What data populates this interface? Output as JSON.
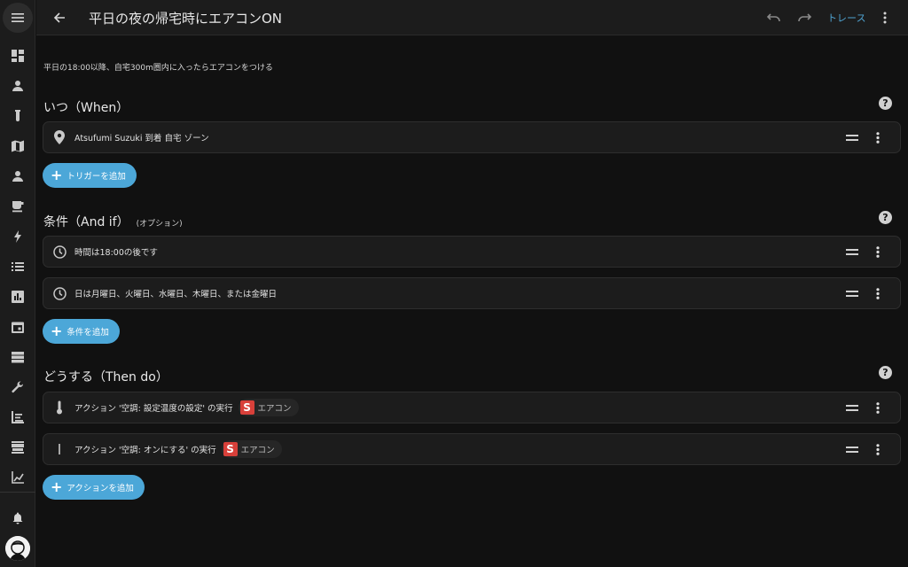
{
  "header": {
    "title": "平日の夜の帰宅時にエアコンON",
    "trace_label": "トレース"
  },
  "description": "平日の18:00以降、自宅300m圏内に入ったらエアコンをつける",
  "sections": {
    "when": {
      "title": "いつ（When）",
      "items": [
        {
          "icon": "map-marker-icon",
          "text": "Atsufumi Suzuki 到着 自宅 ゾーン"
        }
      ],
      "add_label": "トリガーを追加"
    },
    "and_if": {
      "title": "条件（And if）",
      "optional": "(オプション)",
      "items": [
        {
          "icon": "clock-icon",
          "text": "時間は18:00の後です"
        },
        {
          "icon": "clock-icon",
          "text": "日は月曜日、火曜日、水曜日、木曜日、または金曜日"
        }
      ],
      "add_label": "条件を追加"
    },
    "then_do": {
      "title": "どうする（Then do）",
      "items": [
        {
          "icon": "thermometer-icon",
          "text": "アクション '空調: 設定温度の設定' の実行",
          "chip_badge": "S",
          "chip_label": "エアコン"
        },
        {
          "icon": "power-icon",
          "text": "アクション '空調: オンにする' の実行",
          "chip_badge": "S",
          "chip_label": "エアコン"
        }
      ],
      "add_label": "アクションを追加"
    }
  },
  "help_symbol": "?",
  "plus_symbol": "+",
  "colors": {
    "accent": "#4ca7d8",
    "background": "#111111",
    "card": "#1c1c1c",
    "badge": "#d8403a"
  }
}
